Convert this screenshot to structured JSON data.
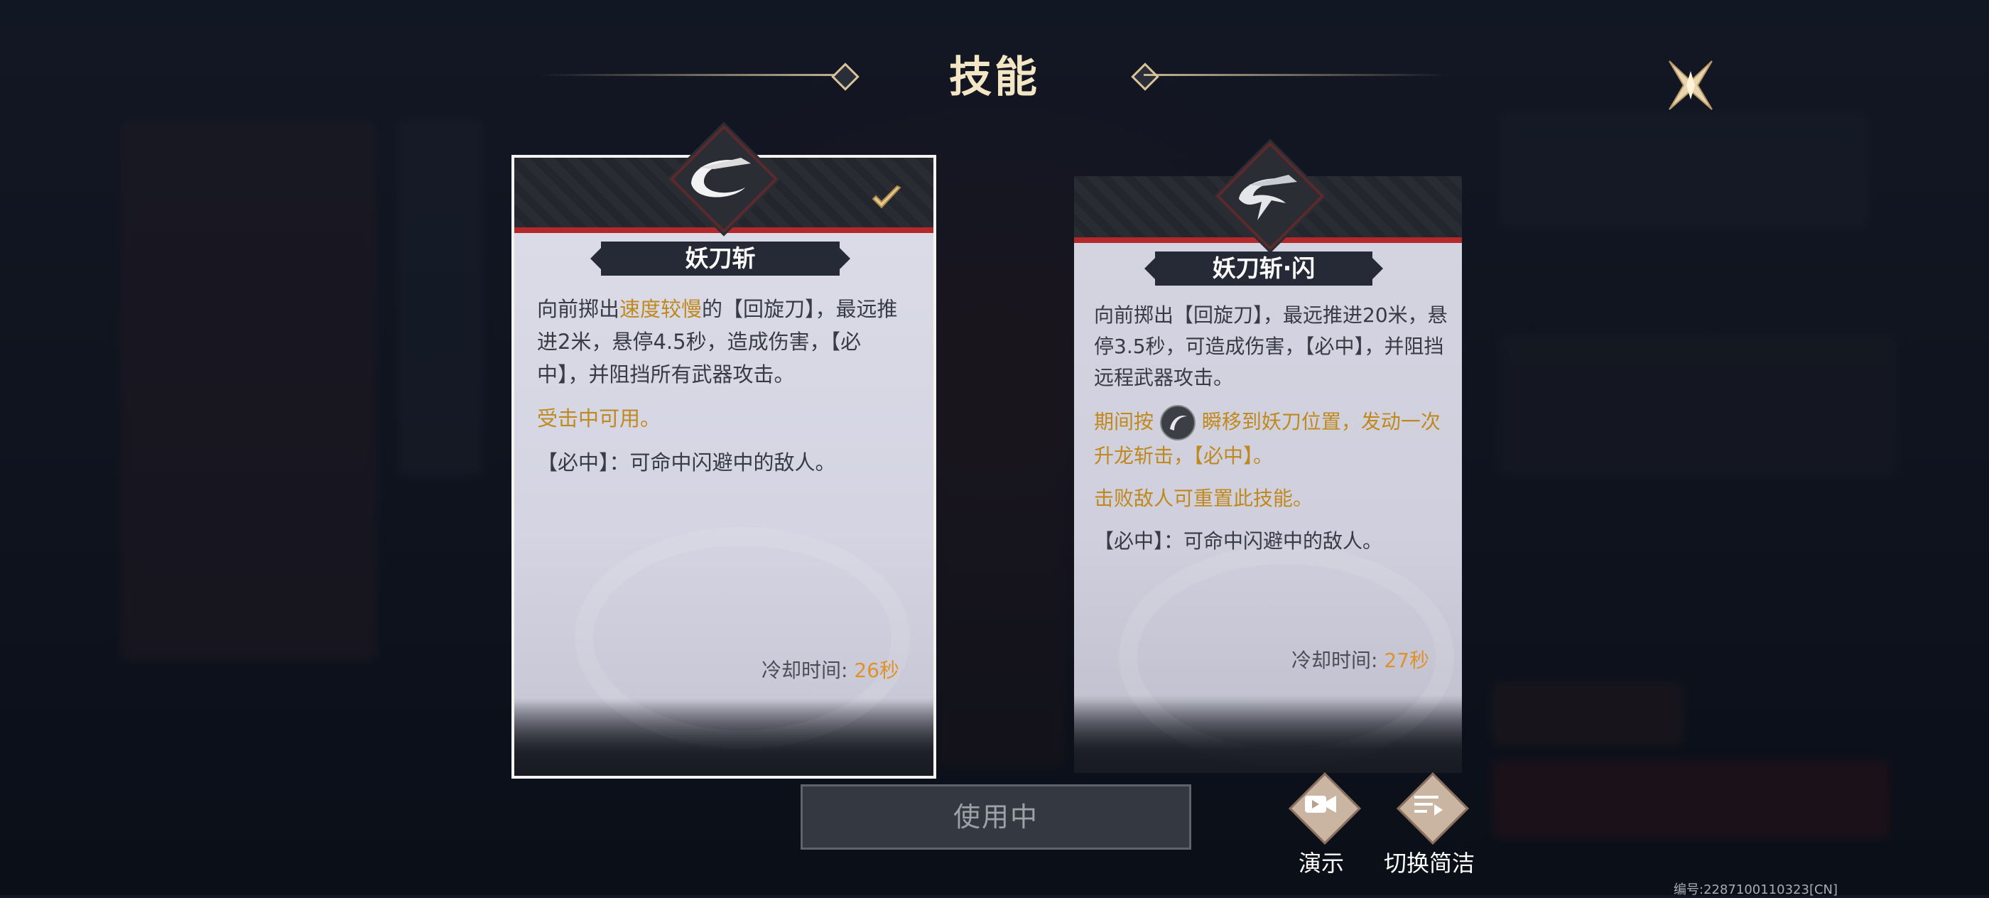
{
  "header": {
    "title": "技能"
  },
  "cards": [
    {
      "name": "妖刀斩",
      "selected": true,
      "paragraphs": [
        {
          "segments": [
            {
              "text": "向前掷出",
              "hl": false
            },
            {
              "text": "速度较慢",
              "hl": true
            },
            {
              "text": "的【回旋刀】，最远推进2米，悬停4.5秒，造成伤害，【必中】，并阻挡所有武器攻击。",
              "hl": false
            }
          ]
        },
        {
          "segments": [
            {
              "text": "受击中可用。",
              "hl": true
            }
          ]
        },
        {
          "segments": [
            {
              "text": "【必中】：可命中闪避中的敌人。",
              "hl": false
            }
          ]
        }
      ],
      "cooldown_label": "冷却时间:",
      "cooldown_value": "26秒"
    },
    {
      "name": "妖刀斩·闪",
      "selected": false,
      "paragraphs": [
        {
          "segments": [
            {
              "text": "向前掷出【回旋刀】，最远推进20米，悬停3.5秒，可造成伤害，【必中】，并阻挡远程武器攻击。",
              "hl": false
            }
          ]
        },
        {
          "segments": [
            {
              "text": "期间按",
              "hl": true
            },
            {
              "text": "[icon]",
              "hl": true,
              "icon": "skill-button-icon"
            },
            {
              "text": "瞬移到妖刀位置，发动一次升龙斩击，【必中】。",
              "hl": true
            }
          ]
        },
        {
          "segments": [
            {
              "text": "击败敌人可重置此技能。",
              "hl": true
            }
          ]
        },
        {
          "segments": [
            {
              "text": "【必中】：可命中闪避中的敌人。",
              "hl": false
            }
          ]
        }
      ],
      "cooldown_label": "冷却时间:",
      "cooldown_value": "27秒"
    }
  ],
  "buttons": {
    "use": "使用中",
    "demo": "演示",
    "switch": "切换简洁"
  },
  "footer": {
    "code": "编号:2287100110323[CN]"
  },
  "colors": {
    "highlight": "#c0891e",
    "cooldown_value": "#e0922a",
    "title": "#f3e6c4",
    "accent_red": "#b3282b"
  },
  "icons": [
    "close-icon",
    "checkmark-icon",
    "blade-emblem-icon",
    "video-icon",
    "list-toggle-icon",
    "skill-button-icon"
  ]
}
